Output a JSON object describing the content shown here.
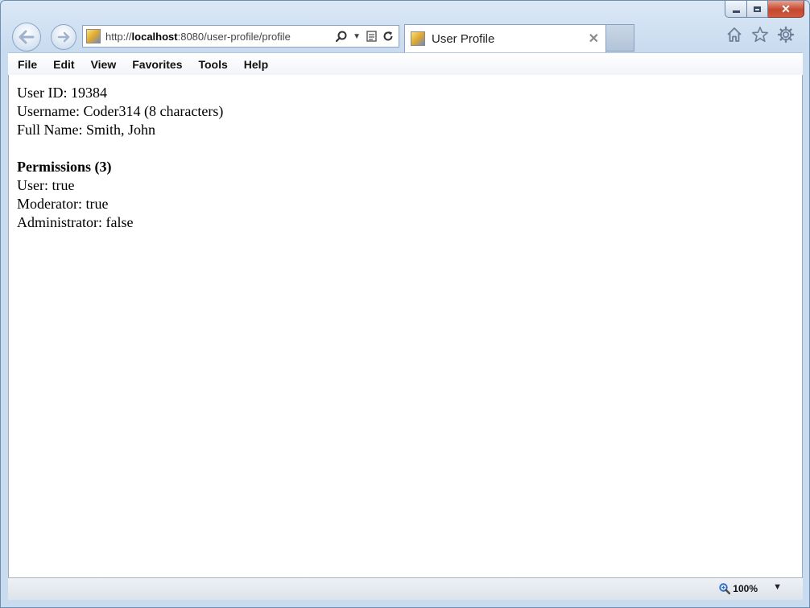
{
  "browser": {
    "url_prefix": "http://",
    "url_host": "localhost",
    "url_rest": ":8080/user-profile/profile",
    "tab_title": "User Profile",
    "zoom": "100%"
  },
  "menu": [
    "File",
    "Edit",
    "View",
    "Favorites",
    "Tools",
    "Help"
  ],
  "profile": {
    "user_id": "User ID: 19384",
    "username": "Username: Coder314 (8 characters)",
    "full_name": "Full Name: Smith, John"
  },
  "permissions": {
    "heading": "Permissions (3)",
    "items": [
      "User: true",
      "Moderator: true",
      "Administrator: false"
    ]
  },
  "icons": {
    "back": "back-arrow-icon",
    "forward": "forward-arrow-icon",
    "search": "search-icon",
    "compat": "compatibility-view-icon",
    "refresh": "refresh-icon",
    "home": "home-icon",
    "favorites": "favorites-star-icon",
    "tools": "gear-icon",
    "zoom": "zoom-icon"
  }
}
